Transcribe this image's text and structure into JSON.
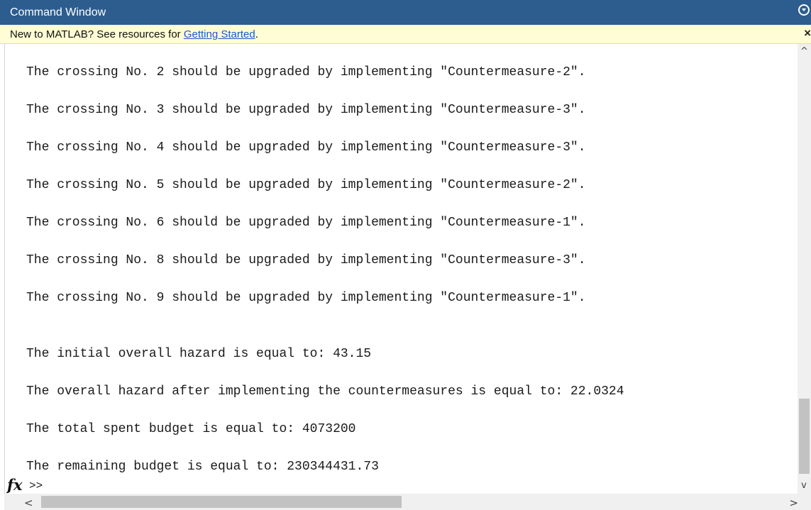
{
  "window": {
    "title": "Command Window"
  },
  "notice": {
    "prefix": "New to MATLAB? See resources for ",
    "link": "Getting Started",
    "suffix": ".",
    "close_glyph": "×"
  },
  "output": {
    "lines": [
      "The crossing No. 2 should be upgraded by implementing \"Countermeasure-2\".",
      "The crossing No. 3 should be upgraded by implementing \"Countermeasure-3\".",
      "The crossing No. 4 should be upgraded by implementing \"Countermeasure-3\".",
      "The crossing No. 5 should be upgraded by implementing \"Countermeasure-2\".",
      "The crossing No. 6 should be upgraded by implementing \"Countermeasure-1\".",
      "The crossing No. 8 should be upgraded by implementing \"Countermeasure-3\".",
      "The crossing No. 9 should be upgraded by implementing \"Countermeasure-1\".",
      "The initial overall hazard is equal to: 43.15",
      "The overall hazard after implementing the countermeasures is equal to: 22.0324",
      "The total spent budget is equal to: 4073200",
      "The remaining budget is equal to: 230344431.73"
    ]
  },
  "prompt": {
    "fx": "fx",
    "symbol": ">>"
  },
  "scroll": {
    "up": "^",
    "down": "v",
    "left": "<",
    "right": ">"
  }
}
